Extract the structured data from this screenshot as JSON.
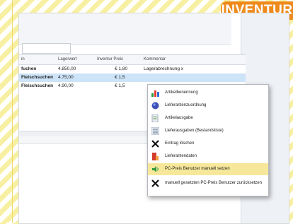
{
  "badge": {
    "label": "INVENTUR"
  },
  "filter": {
    "placeholder": ""
  },
  "grid": {
    "columns": [
      "in",
      "Lagerwert",
      "Inventur Preis",
      "Kommentar"
    ],
    "rows": [
      {
        "name": "fuchen",
        "lagerwert": "4.850,00",
        "preis": "€ 1,80",
        "kommentar": "Lagerabrechnung x"
      },
      {
        "name": "Fleischsuchen",
        "lagerwert": "4.75,00",
        "preis": "€ 1,5",
        "kommentar": ""
      },
      {
        "name": "Fleischsuchen",
        "lagerwert": "4.90,00",
        "preis": "€ 1,5",
        "kommentar": ""
      }
    ]
  },
  "menu": {
    "items": [
      {
        "label": "Artikelbenennung",
        "icon": "chart-icon",
        "highlighted": false
      },
      {
        "label": "Lieferantenzuordnung",
        "icon": "globe-icon",
        "highlighted": false
      },
      {
        "label": "Artikelausgabe",
        "icon": "document-icon",
        "highlighted": false
      },
      {
        "label": "Lieferausgaben (Bestandsliste)",
        "icon": "list-icon",
        "highlighted": false
      },
      {
        "label": "Eintrag löschen",
        "icon": "close-x-icon",
        "highlighted": false
      },
      {
        "label": "Lieferantendaten",
        "icon": "bookmark-icon",
        "highlighted": false
      },
      {
        "label": "PC-Preis Benutzer manuell setzen",
        "icon": "speaker-icon",
        "highlighted": true
      },
      {
        "label": "manuell gesetzten PC-Preis Benutzer zurücksetzen",
        "icon": "close-x-icon",
        "highlighted": false
      }
    ]
  },
  "colors": {
    "badge": "#ee8a1c",
    "stripe": "#f7f0a2",
    "highlight": "#f7e79a",
    "selection": "#cde3f7"
  }
}
